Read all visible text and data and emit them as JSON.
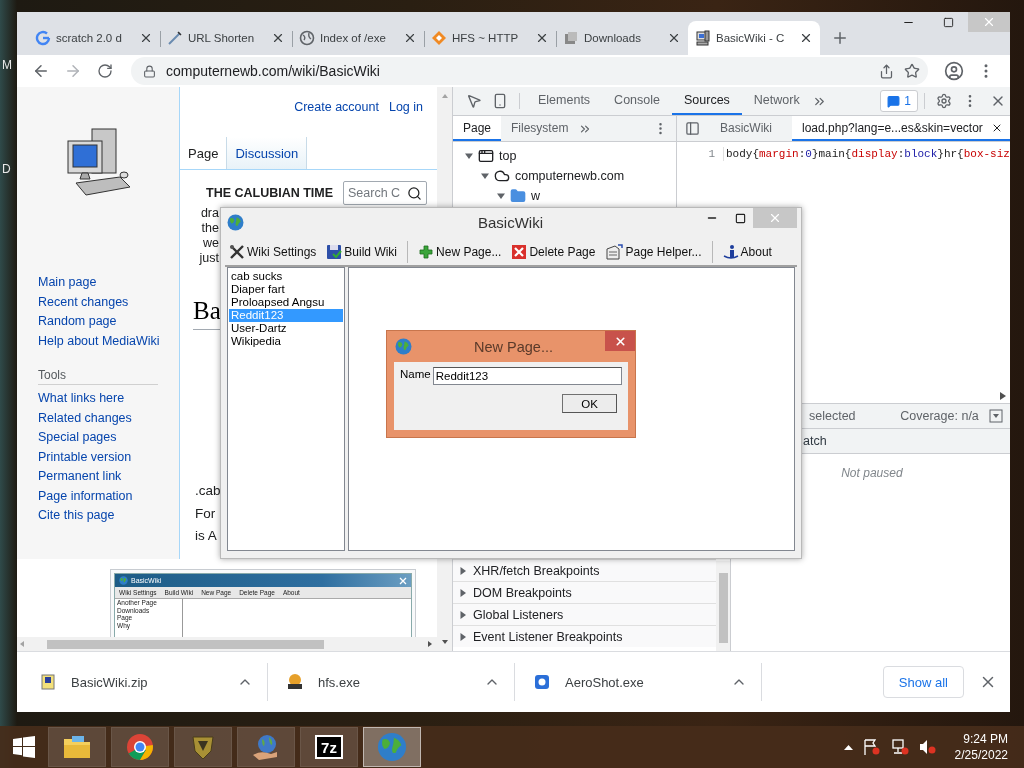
{
  "desktop": {
    "labels": [
      "M",
      "D"
    ]
  },
  "browser": {
    "tabs": [
      {
        "title": "scratch 2.0 d",
        "selected": false
      },
      {
        "title": "URL Shorten",
        "selected": false
      },
      {
        "title": "Index of /exe",
        "selected": false
      },
      {
        "title": "HFS ~ HTTP",
        "selected": false
      },
      {
        "title": "Downloads",
        "selected": false
      },
      {
        "title": "BasicWiki - C",
        "selected": true
      }
    ],
    "address": "computernewb.com/wiki/BasicWiki",
    "wiki": {
      "user_links": [
        "Create account",
        "Log in"
      ],
      "page_tabs": [
        {
          "label": "Page",
          "selected": true
        },
        {
          "label": "Discussion",
          "selected": false
        }
      ],
      "banner": "THE CALUBIAN TIME",
      "search": {
        "placeholder": "Search C"
      },
      "intro_fragments": [
        "dra",
        "the",
        "we",
        "just"
      ],
      "heading": "Ba",
      "body_fragments": [
        ".cab",
        "For",
        "is A"
      ],
      "nav": [
        "Main page",
        "Recent changes",
        "Random page",
        "Help about MediaWiki"
      ],
      "tools": {
        "heading": "Tools",
        "links": [
          "What links here",
          "Related changes",
          "Special pages",
          "Printable version",
          "Permanent link",
          "Page information",
          "Cite this page"
        ]
      },
      "thumbnail": {
        "title": "BasicWiki",
        "toolbar": [
          "Wiki Settings",
          "Build Wiki",
          "New Page",
          "Delete Page",
          "About"
        ],
        "pages": [
          "Another Page",
          "Downloads",
          "Page",
          "Why"
        ]
      }
    },
    "devtools": {
      "tabs": [
        {
          "label": "Elements",
          "selected": false
        },
        {
          "label": "Console",
          "selected": false
        },
        {
          "label": "Sources",
          "selected": true
        },
        {
          "label": "Network",
          "selected": false
        }
      ],
      "issues_badge": "1",
      "navigator_tabs": [
        {
          "label": "Page",
          "selected": true
        },
        {
          "label": "Filesystem",
          "selected": false
        }
      ],
      "editor_tabs": [
        {
          "label": "BasicWiki",
          "selected": false
        },
        {
          "label": "load.php?lang=e...es&skin=vector",
          "selected": true
        }
      ],
      "tree": [
        {
          "label": "top",
          "expanded": true,
          "children": [
            {
              "label": "computernewb.com",
              "expanded": true,
              "children": [
                {
                  "label": "w",
                  "expanded": true
                }
              ]
            }
          ]
        }
      ],
      "code_lines": [
        {
          "number": "1",
          "text": "body{margin:0}main{display:block}hr{box-siz"
        }
      ],
      "status": "selected",
      "coverage": "Coverage: n/a",
      "watch_header": "atch",
      "scope_message": "Not paused",
      "breakpoint_sections": [
        {
          "label": "XHR/fetch Breakpoints",
          "expanded": false
        },
        {
          "label": "DOM Breakpoints",
          "expanded": false
        },
        {
          "label": "Global Listeners",
          "expanded": false
        },
        {
          "label": "Event Listener Breakpoints",
          "expanded": false
        }
      ]
    },
    "downloads": {
      "items": [
        {
          "name": "BasicWiki.zip"
        },
        {
          "name": "hfs.exe"
        },
        {
          "name": "AeroShot.exe"
        }
      ],
      "show_all": "Show all"
    }
  },
  "app_window": {
    "title": "BasicWiki",
    "toolbar_groups": [
      {
        "buttons": [
          "Wiki Settings",
          "Build Wiki"
        ]
      },
      {
        "buttons": [
          "New Page...",
          "Delete Page",
          "Page Helper..."
        ]
      },
      {
        "buttons": [
          "About"
        ]
      }
    ],
    "pages": [
      {
        "name": "cab sucks",
        "selected": false
      },
      {
        "name": "Diaper fart",
        "selected": false
      },
      {
        "name": "Proloapsed Angsu",
        "selected": false
      },
      {
        "name": "Reddit123",
        "selected": true
      },
      {
        "name": "User-Dartz",
        "selected": false
      },
      {
        "name": "Wikipedia",
        "selected": false
      }
    ]
  },
  "dialog": {
    "title": "New Page...",
    "field_label": "Name",
    "value": "Reddit123",
    "ok": "OK"
  },
  "taskbar": {
    "apps": [
      {
        "selected": false
      },
      {
        "selected": false
      },
      {
        "selected": false
      },
      {
        "selected": false
      },
      {
        "label": "7z",
        "selected": false
      },
      {
        "selected": true
      }
    ],
    "time": "9:24 PM",
    "date": "2/25/2022"
  }
}
